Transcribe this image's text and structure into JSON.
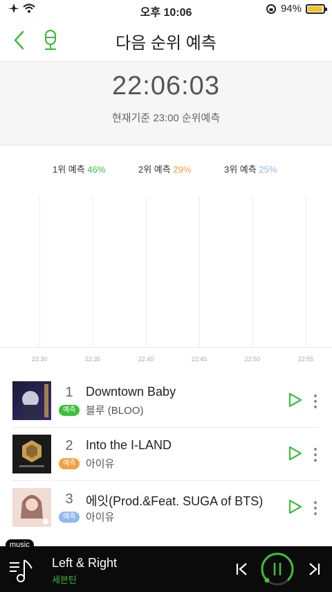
{
  "status": {
    "time": "오후 10:06",
    "battery": "94%",
    "battery_level": 0.94
  },
  "header": {
    "title": "다음 순위 예측",
    "back_icon": "chevron-left-icon",
    "mic_icon": "microphone-icon"
  },
  "clock": {
    "time": "22:06:03",
    "subtitle": "현재기준 23:00 순위예측"
  },
  "legend": [
    {
      "label": "1위 예측",
      "pct": "46%",
      "color": "#3ebd3e"
    },
    {
      "label": "2위 예측",
      "pct": "29%",
      "color": "#f0a040"
    },
    {
      "label": "3위 예측",
      "pct": "25%",
      "color": "#8fb8f0"
    }
  ],
  "chart_data": {
    "type": "line",
    "x": [
      "22:30",
      "22:35",
      "22:40",
      "22:45",
      "22:50",
      "22:55"
    ],
    "series": [],
    "grid": true
  },
  "songs": [
    {
      "rank": "1",
      "badge": "예측",
      "badge_color": "#3ebd3e",
      "title": "Downtown Baby",
      "artist": "블루 (BLOO)"
    },
    {
      "rank": "2",
      "badge": "예측",
      "badge_color": "#f0a040",
      "title": "Into the I-LAND",
      "artist": "아이유"
    },
    {
      "rank": "3",
      "badge": "예측",
      "badge_color": "#8fb8f0",
      "title": "에잇(Prod.&Feat. SUGA of BTS)",
      "artist": "아이유"
    }
  ],
  "player": {
    "tag": "music",
    "title": "Left & Right",
    "artist": "세븐틴",
    "accent": "#3ebd3e"
  }
}
